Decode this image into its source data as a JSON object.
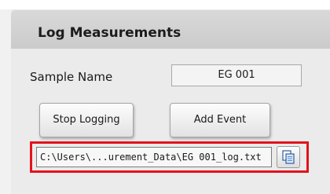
{
  "panel": {
    "title": "Log Measurements"
  },
  "sample": {
    "label": "Sample Name",
    "value": "EG 001"
  },
  "buttons": {
    "stop_logging": "Stop Logging",
    "add_event": "Add Event"
  },
  "log_path": {
    "value": "C:\\Users\\...urement_Data\\EG 001_log.txt",
    "highlight_color": "#e3121b"
  },
  "icons": {
    "copy": "copy-path-icon"
  }
}
